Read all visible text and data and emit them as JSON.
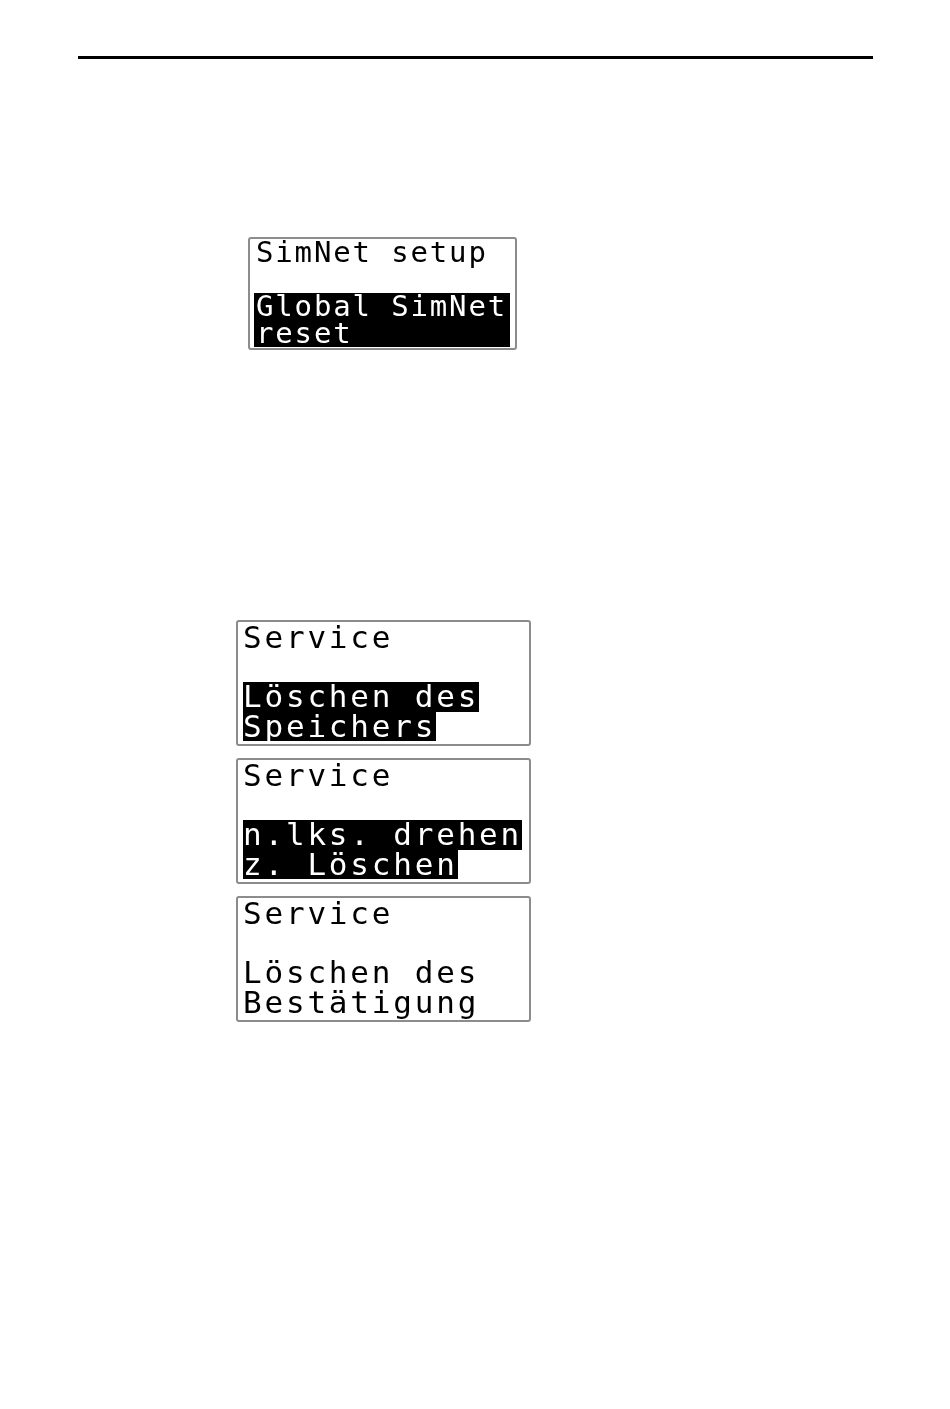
{
  "figures": [
    {
      "displays": [
        {
          "title": "SimNet setup",
          "kind": "block",
          "selected": true,
          "lines": [
            "Global SimNet",
            "reset"
          ]
        }
      ]
    },
    {
      "displays": [
        {
          "title": "Service",
          "kind": "lines",
          "selected": true,
          "lines": [
            "Löschen des",
            "Speichers"
          ]
        },
        {
          "title": "Service",
          "kind": "lines",
          "selected": true,
          "lines": [
            "n.lks. drehen",
            "z. Löschen"
          ]
        },
        {
          "title": "Service",
          "kind": "lines",
          "selected": false,
          "lines": [
            "Löschen des",
            "Bestätigung"
          ]
        }
      ]
    }
  ]
}
